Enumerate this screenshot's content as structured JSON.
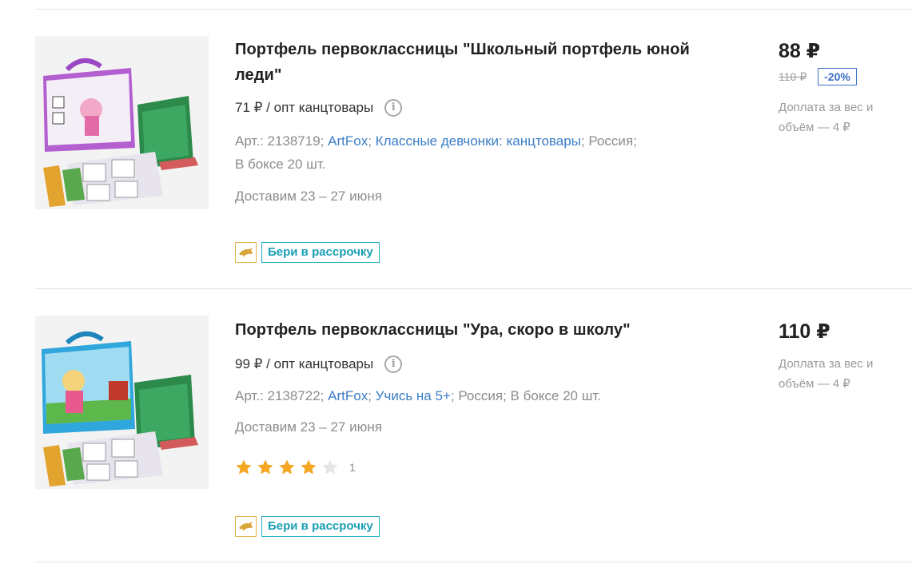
{
  "products": [
    {
      "title": "Портфель первоклассницы \"Школьный портфель юной леди\"",
      "opt_price": "71 ₽ / опт канцтовары",
      "art": "Арт.: 2138719;",
      "brand": "ArtFox",
      "series": "Классные девчонки: канцтовары",
      "country": "Россия;",
      "box": "В боксе 20 шт.",
      "delivery": "Доставим 23 – 27 июня",
      "installment_label": "Бери в рассрочку",
      "price": "88 ₽",
      "old_price": "110 ₽",
      "discount": "-20%",
      "surcharge": "Доплата за вес и объём — 4 ₽"
    },
    {
      "title": "Портфель первоклассницы \"Ура, скоро в школу\"",
      "opt_price": "99 ₽ / опт канцтовары",
      "art": "Арт.: 2138722;",
      "brand": "ArtFox",
      "series": "Учись на 5+",
      "country": "Россия;",
      "box": "В боксе 20 шт.",
      "delivery": "Доставим 23 – 27 июня",
      "rating": 4,
      "rating_max": 5,
      "rating_count": "1",
      "installment_label": "Бери в рассрочку",
      "price": "110 ₽",
      "surcharge": "Доплата за вес и объём — 4 ₽"
    }
  ],
  "colors": {
    "link": "#3a7ec6",
    "accent_teal": "#1a9fb3",
    "star": "#f5a623",
    "discount_blue": "#3a6fc6"
  }
}
